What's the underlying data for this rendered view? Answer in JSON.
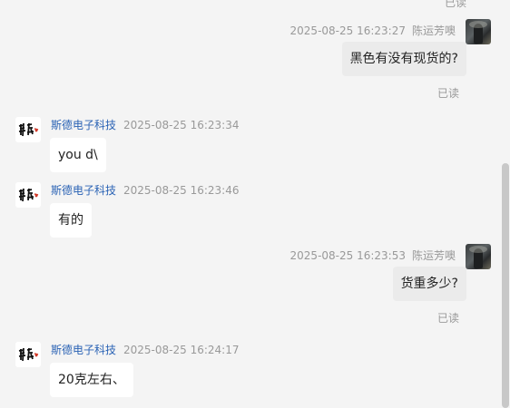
{
  "messages": [
    {
      "direction": "out",
      "time": "2025-08-25 16:23:27",
      "sender": "陈运芳噢",
      "text": "黑色有没有现货的?",
      "status": "已读"
    },
    {
      "direction": "in",
      "time": "2025-08-25 16:23:34",
      "sender": "斯德电子科技",
      "text": "you d\\"
    },
    {
      "direction": "in",
      "time": "2025-08-25 16:23:46",
      "sender": "斯德电子科技",
      "text": "有的"
    },
    {
      "direction": "out",
      "time": "2025-08-25 16:23:53",
      "sender": "陈运芳噢",
      "text": "货重多少?",
      "status": "已读"
    },
    {
      "direction": "in",
      "time": "2025-08-25 16:24:17",
      "sender": "斯德电子科技",
      "text": "20克左右、"
    }
  ],
  "top_status": "已读",
  "icons": {
    "user_avatar": "user-photo-avatar",
    "shop_avatar": "shop-logo-avatar"
  },
  "colors": {
    "background": "#f4f4f4",
    "sender_link": "#2b63b5",
    "meta_gray": "#999999",
    "outgoing_bubble": "#ebebeb",
    "incoming_bubble": "#ffffff"
  }
}
